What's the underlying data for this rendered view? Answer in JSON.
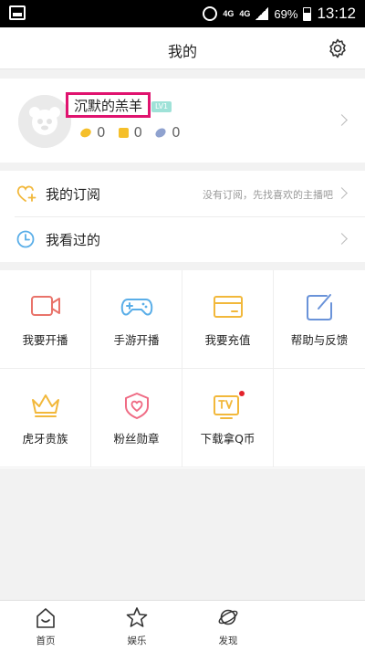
{
  "status_bar": {
    "network1": "4G",
    "network2": "4G",
    "battery": "69%",
    "time": "13:12"
  },
  "header": {
    "title": "我的"
  },
  "profile": {
    "username": "沉默的羔羊",
    "level": "LV1",
    "coins": [
      {
        "name": "gold-bean",
        "value": "0"
      },
      {
        "name": "gold-coin",
        "value": "0"
      },
      {
        "name": "silver-bean",
        "value": "0"
      }
    ]
  },
  "list": {
    "subscriptions": {
      "label": "我的订阅",
      "hint": "没有订阅，先找喜欢的主播吧"
    },
    "history": {
      "label": "我看过的"
    }
  },
  "grid": [
    {
      "label": "我要开播",
      "icon": "camera-icon",
      "color": "#e9736a"
    },
    {
      "label": "手游开播",
      "icon": "gamepad-icon",
      "color": "#5aaee8"
    },
    {
      "label": "我要充值",
      "icon": "wallet-icon",
      "color": "#f2b83b"
    },
    {
      "label": "帮助与反馈",
      "icon": "edit-icon",
      "color": "#6a93d9"
    },
    {
      "label": "虎牙贵族",
      "icon": "crown-icon",
      "color": "#f2b83b"
    },
    {
      "label": "粉丝勋章",
      "icon": "badge-icon",
      "color": "#ef6b84"
    },
    {
      "label": "下载拿Q币",
      "icon": "tv-icon",
      "color": "#f2b83b"
    }
  ],
  "tabs": [
    {
      "label": "首页",
      "icon": "home-icon"
    },
    {
      "label": "娱乐",
      "icon": "star-icon"
    },
    {
      "label": "发现",
      "icon": "planet-icon"
    }
  ]
}
